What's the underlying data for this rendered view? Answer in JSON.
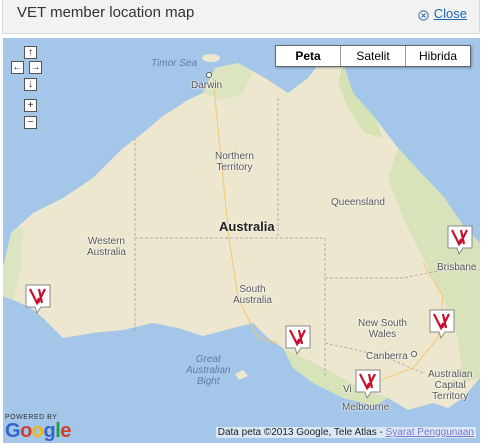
{
  "header": {
    "title": "VET member location map",
    "close_label": "Close"
  },
  "map_type": {
    "buttons": [
      "Peta",
      "Satelit",
      "Hibrida"
    ],
    "selected": "Peta"
  },
  "nav": {
    "up": "↑",
    "left": "←",
    "right": "→",
    "down": "↓",
    "zoom_in": "+",
    "zoom_out": "−"
  },
  "labels": {
    "timor_sea": "Timor Sea",
    "darwin": "Darwin",
    "northern_territory": "Northern\nTerritory",
    "queensland": "Queensland",
    "western_australia": "Western\nAustralia",
    "australia": "Australia",
    "south_australia": "South\nAustralia",
    "brisbane": "Brisbane",
    "new_south_wales": "New South\nWales",
    "canberra": "Canberra",
    "act": "Australian\nCapital\nTerritory",
    "melbourne": "Melbourne",
    "victoria_partial": "Vi",
    "great_australian_bight": "Great\nAustralian\nBight"
  },
  "footer": {
    "powered_by": "POWERED BY",
    "google": "Google",
    "attribution": "Data peta ©2013 Google, Tele Atlas - ",
    "terms": "Syarat Penggunaan"
  },
  "colors": {
    "water": "#9ec4e8",
    "land": "#ede7cf",
    "land_green": "#cfe0b0",
    "marker_red": "#c8102e"
  },
  "markers": [
    {
      "name": "marker-perth"
    },
    {
      "name": "marker-adelaide"
    },
    {
      "name": "marker-melbourne"
    },
    {
      "name": "marker-sydney"
    },
    {
      "name": "marker-brisbane"
    }
  ]
}
